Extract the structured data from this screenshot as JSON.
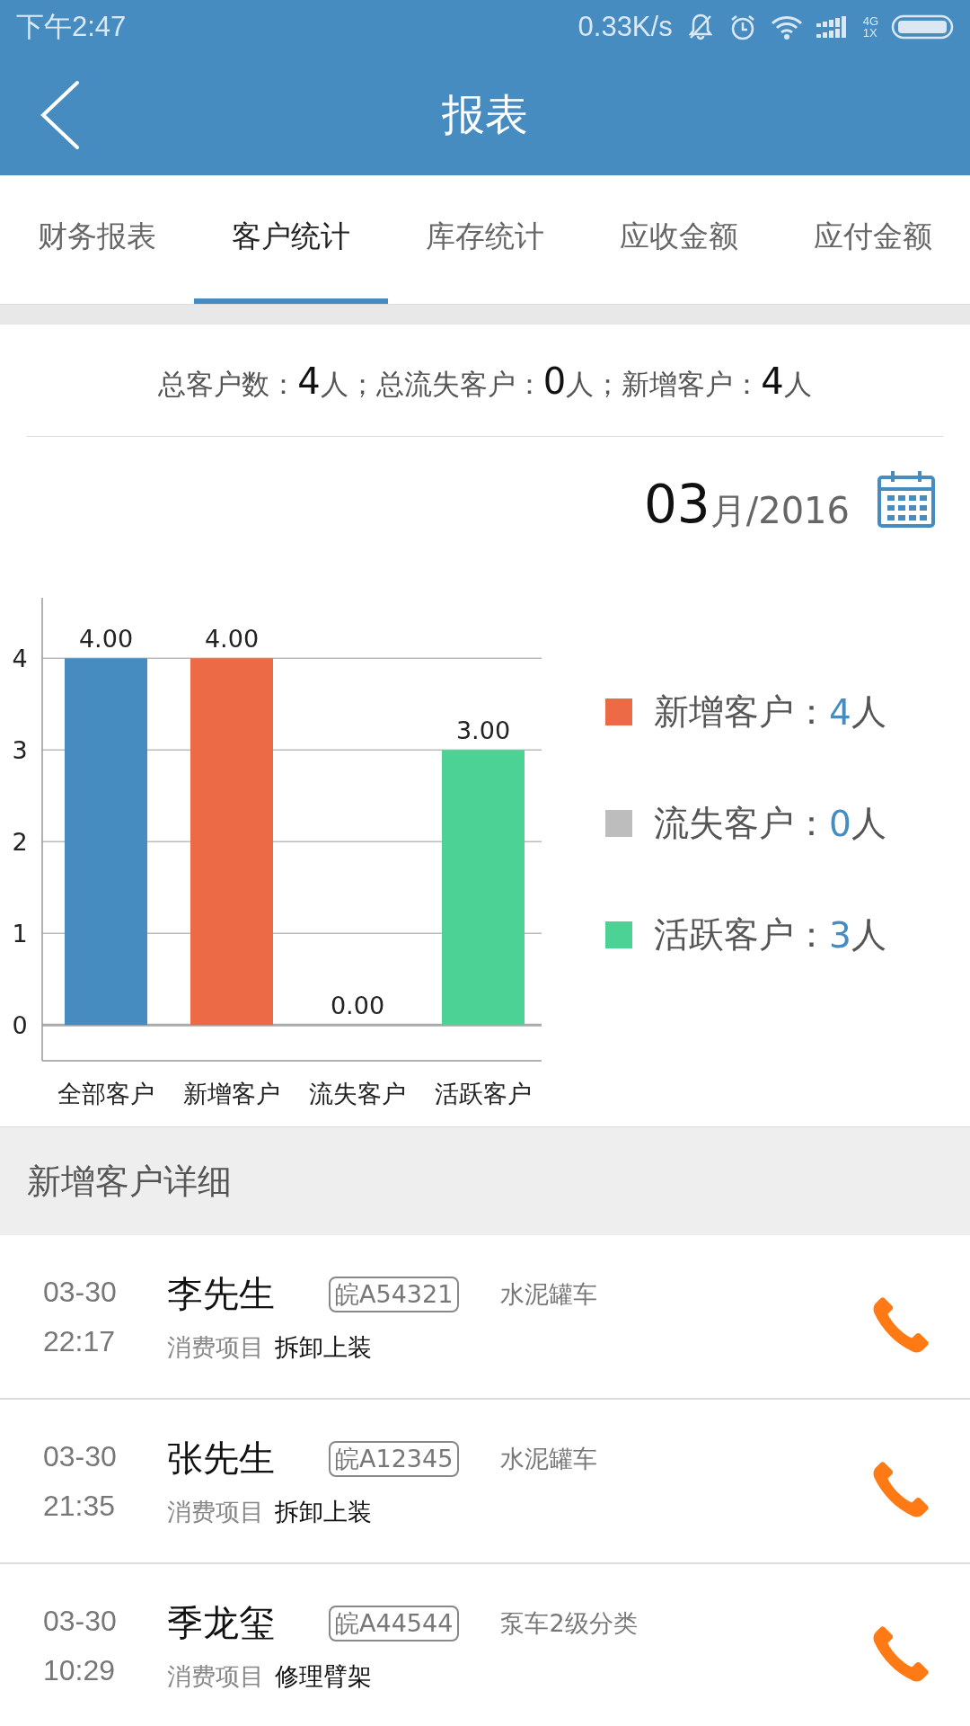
{
  "status_bar": {
    "time": "下午2:47",
    "speed": "0.33K/s",
    "network_top": "4G",
    "network_bottom": "1X"
  },
  "app_bar": {
    "title": "报表"
  },
  "tabs": [
    {
      "label": "财务报表",
      "selected": false
    },
    {
      "label": "客户统计",
      "selected": true
    },
    {
      "label": "库存统计",
      "selected": false
    },
    {
      "label": "应收金额",
      "selected": false
    },
    {
      "label": "应付金额",
      "selected": false
    }
  ],
  "summary": "总客户数：**4**人；总流失客户：**0**人；新增客户：**4**人",
  "date": {
    "month": "03",
    "rest": "月/2016"
  },
  "chart_data": {
    "type": "bar",
    "categories": [
      "全部客户",
      "新增客户",
      "流失客户",
      "活跃客户"
    ],
    "series": [
      {
        "values": [
          4,
          4,
          0,
          3
        ]
      }
    ],
    "grid": true,
    "colors": [
      "#468cc1",
      "#ec6a45",
      "#bdbdbd",
      "#4dd295"
    ],
    "ylim": [
      -0.39,
      4.66
    ],
    "yticks": [
      0,
      1,
      2,
      3,
      4
    ],
    "value_labels": [
      "4.00",
      "4.00",
      "0.00",
      "3.00"
    ]
  },
  "legend": [
    {
      "label": "新增客户：",
      "value": "4",
      "unit": "人",
      "color": "#ec6a45"
    },
    {
      "label": "流失客户：",
      "value": "0",
      "unit": "人",
      "color": "#bdbdbd"
    },
    {
      "label": "活跃客户：",
      "value": "3",
      "unit": "人",
      "color": "#4dd295"
    }
  ],
  "section_title": "新增客户详细",
  "customers": [
    {
      "date": "03-30",
      "time": "22:17",
      "name": "李先生",
      "plate": "皖A54321",
      "vehicle": "水泥罐车",
      "item_label": "消费项目",
      "item": "拆卸上装"
    },
    {
      "date": "03-30",
      "time": "21:35",
      "name": "张先生",
      "plate": "皖A12345",
      "vehicle": "水泥罐车",
      "item_label": "消费项目",
      "item": "拆卸上装"
    },
    {
      "date": "03-30",
      "time": "10:29",
      "name": "季龙玺",
      "plate": "皖A44544",
      "vehicle": "泵车2级分类",
      "item_label": "消费项目",
      "item": "修理臂架"
    }
  ]
}
